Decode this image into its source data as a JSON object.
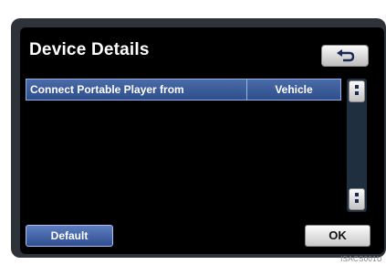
{
  "screen": {
    "title": "Device Details"
  },
  "setting": {
    "label": "Connect Portable Player from",
    "value": "Vehicle"
  },
  "buttons": {
    "default_label": "Default",
    "ok_label": "OK"
  },
  "icons": {
    "back": "back-arrow-icon",
    "scroll_up": "scroll-up-dots-icon",
    "scroll_down": "scroll-down-dots-icon"
  },
  "colors": {
    "screen_bg": "#000000",
    "bezel": "#2d3338",
    "row_highlight": "#3a5c9c",
    "button_light": "#e6e6e6"
  },
  "figure_code": "ISACS001U"
}
